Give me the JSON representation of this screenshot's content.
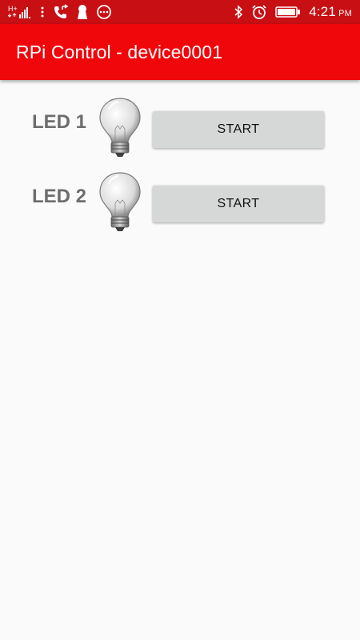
{
  "status_bar": {
    "network_label": "H+",
    "time": "4:21",
    "ampm": "PM",
    "icons": [
      "network-h-plus-icon",
      "signal-bars-icon",
      "more-vert-icon",
      "call-forward-icon",
      "keyhole-icon",
      "chat-bubble-icon",
      "bluetooth-icon",
      "alarm-clock-icon",
      "battery-icon"
    ]
  },
  "app_bar": {
    "title": "RPi Control - device0001",
    "background": "#f0070c"
  },
  "leds": [
    {
      "label": "LED 1",
      "button_label": "START"
    },
    {
      "label": "LED 2",
      "button_label": "START"
    }
  ],
  "colors": {
    "status_bar": "#c70f14",
    "app_bar": "#f0070c",
    "page_background": "#fafafa",
    "label_text": "#6d6d6d",
    "button_background": "#d6d7d7"
  }
}
